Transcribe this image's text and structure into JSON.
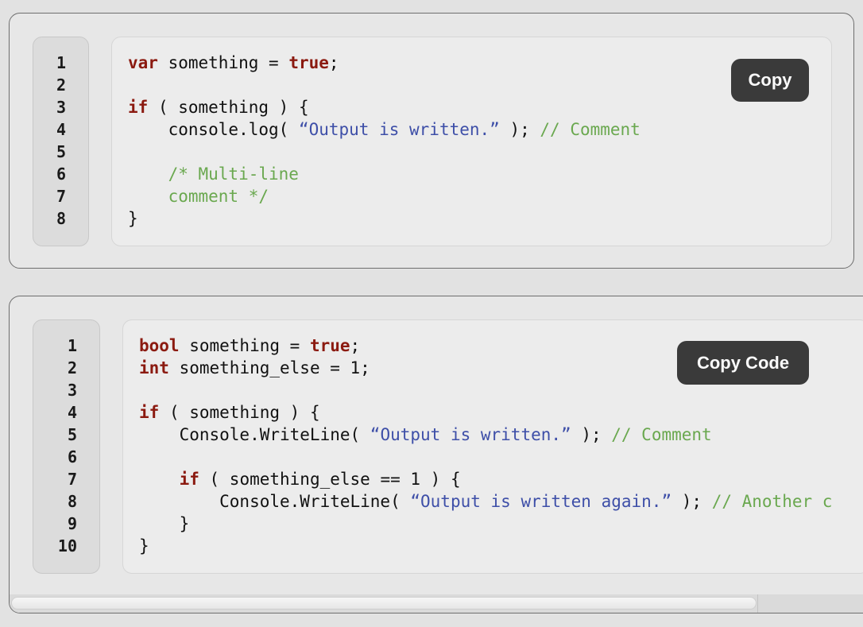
{
  "snippet1": {
    "copy_label": "Copy",
    "line_numbers": [
      "1",
      "2",
      "3",
      "4",
      "5",
      "6",
      "7",
      "8"
    ],
    "code": {
      "l1_kw": "var",
      "l1_a": " something = ",
      "l1_kw2": "true",
      "l1_b": ";",
      "l3_kw": "if",
      "l3_a": " ( something ) {",
      "l4_a": "    console.log( ",
      "l4_str": "“Output is written.”",
      "l4_b": " ); ",
      "l4_cm": "// Comment",
      "l6_cm": "    /* Multi-line",
      "l7_cm": "    comment */",
      "l8_a": "}"
    }
  },
  "snippet2": {
    "copy_label": "Copy Code",
    "line_numbers": [
      "1",
      "2",
      "3",
      "4",
      "5",
      "6",
      "7",
      "8",
      "9",
      "10"
    ],
    "code": {
      "l1_kw": "bool",
      "l1_a": " something = ",
      "l1_kw2": "true",
      "l1_b": ";",
      "l2_kw": "int",
      "l2_a": " something_else = 1;",
      "l4_kw": "if",
      "l4_a": " ( something ) {",
      "l5_a": "    Console.WriteLine( ",
      "l5_str": "“Output is written.”",
      "l5_b": " ); ",
      "l5_cm": "// Comment",
      "l7_pre": "    ",
      "l7_kw": "if",
      "l7_a": " ( something_else == 1 ) {",
      "l8_a": "        Console.WriteLine( ",
      "l8_str": "“Output is written again.”",
      "l8_b": " ); ",
      "l8_cm": "// Another c",
      "l9_a": "    }",
      "l10_a": "}"
    }
  }
}
